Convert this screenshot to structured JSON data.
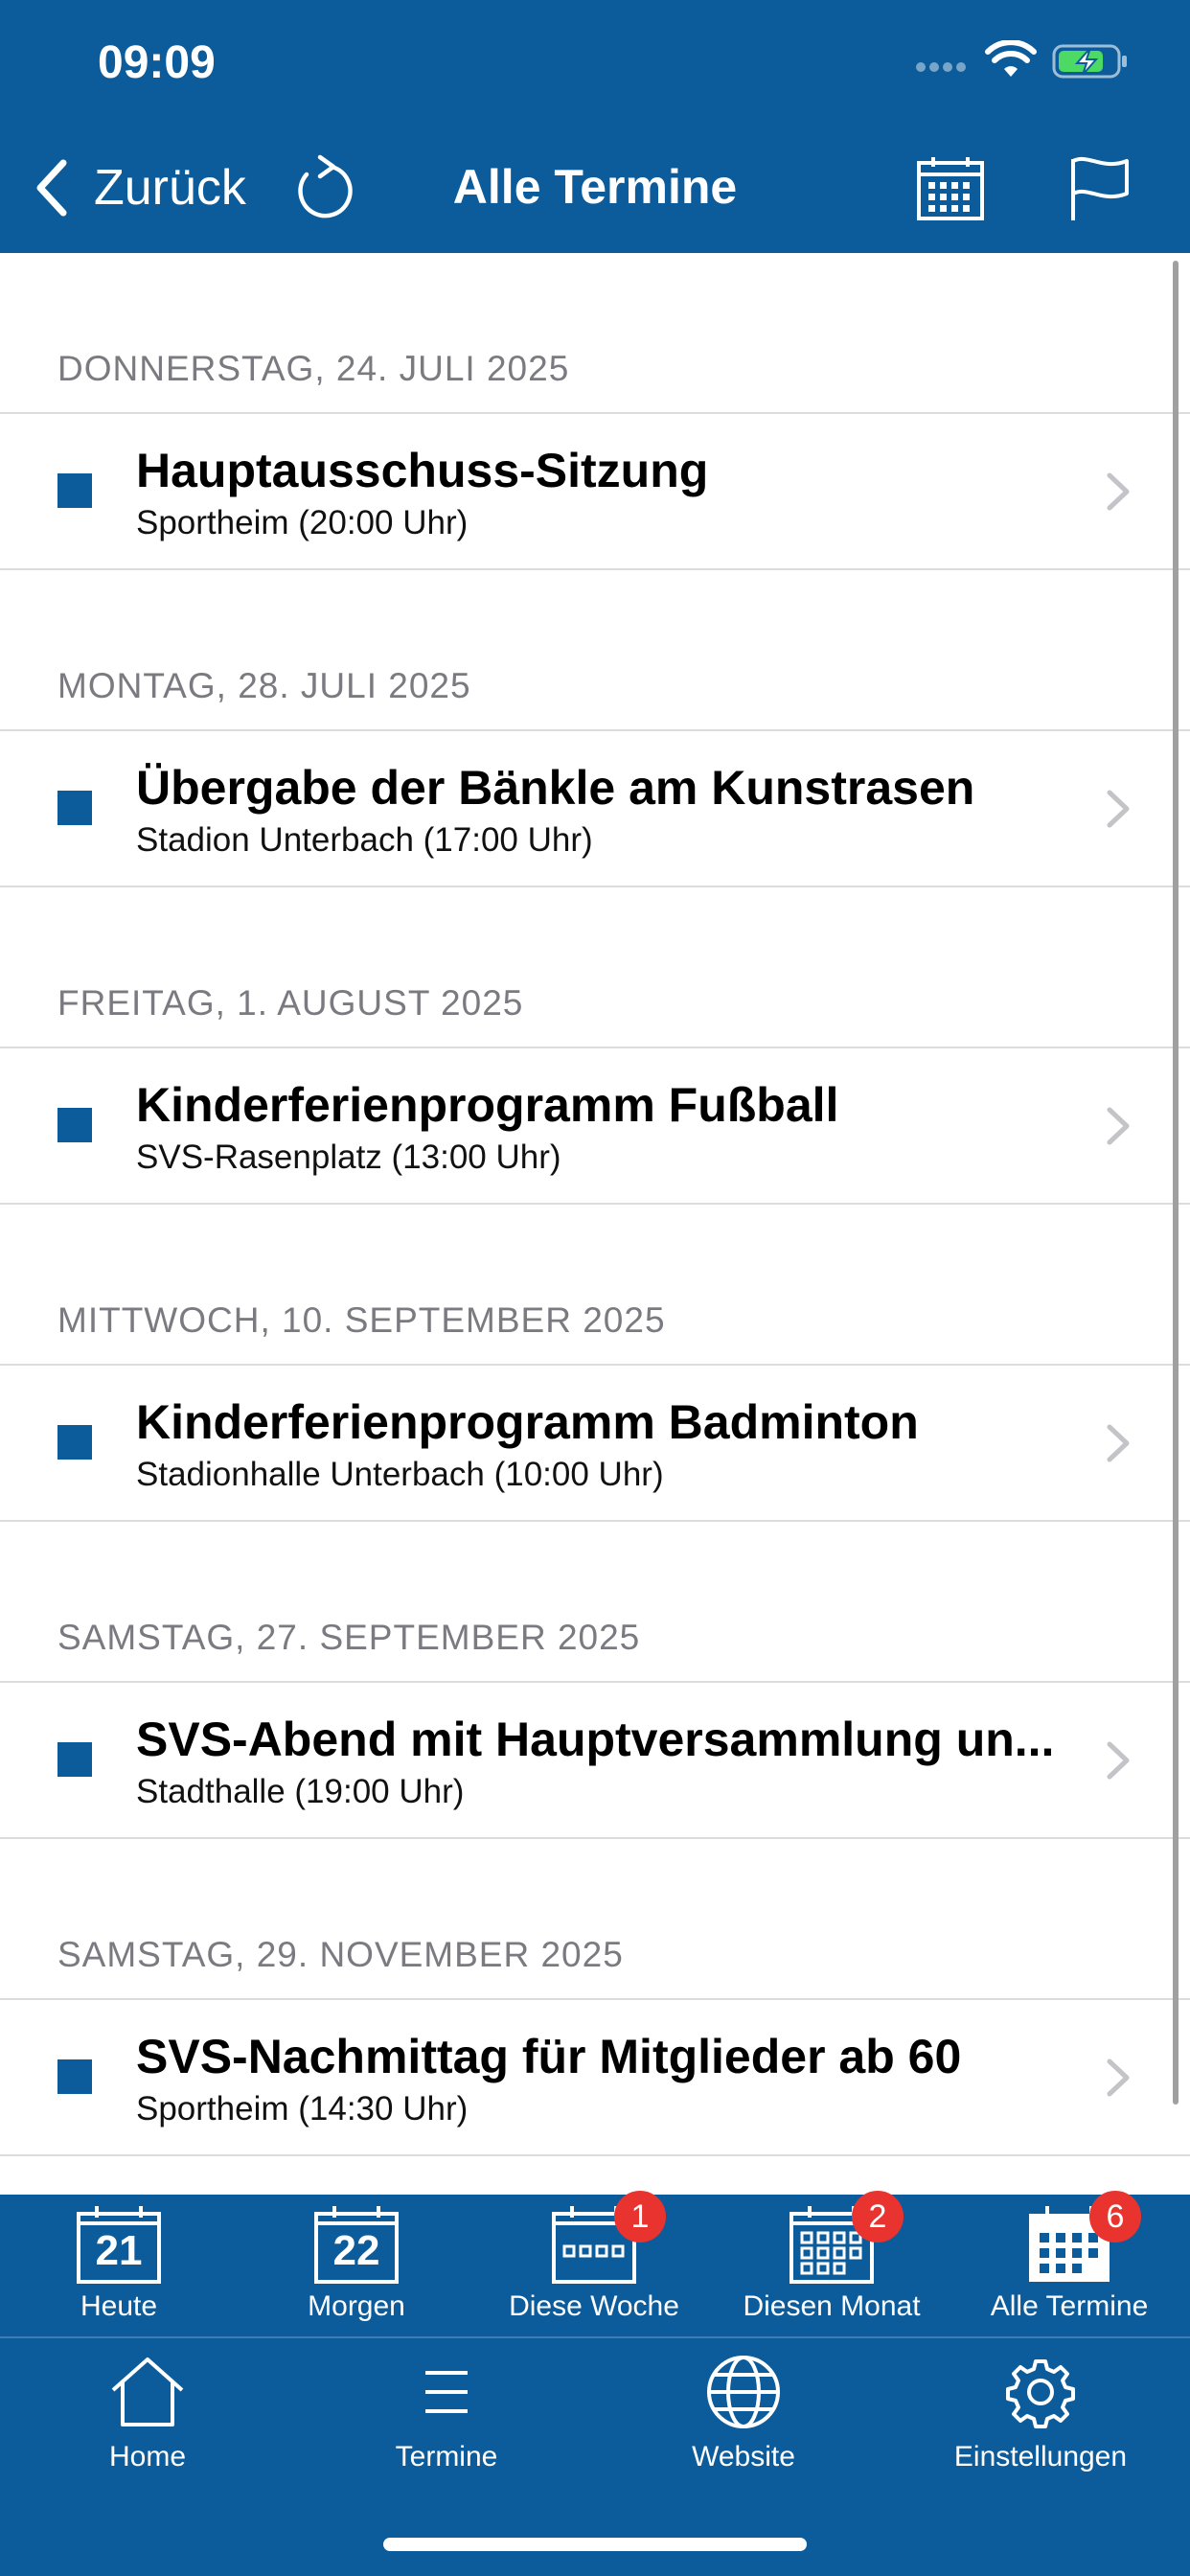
{
  "status": {
    "time": "09:09"
  },
  "nav": {
    "back_label": "Zurück",
    "title": "Alle Termine"
  },
  "sections": [
    {
      "date": "DONNERSTAG, 24. JULI 2025",
      "title": "Hauptausschuss-Sitzung",
      "subtitle": "Sportheim (20:00 Uhr)"
    },
    {
      "date": "MONTAG, 28. JULI 2025",
      "title": "Übergabe der Bänkle am Kunstrasen",
      "subtitle": "Stadion Unterbach (17:00 Uhr)"
    },
    {
      "date": "FREITAG, 1. AUGUST 2025",
      "title": "Kinderferienprogramm Fußball",
      "subtitle": "SVS-Rasenplatz (13:00 Uhr)"
    },
    {
      "date": "MITTWOCH, 10. SEPTEMBER 2025",
      "title": "Kinderferienprogramm Badminton",
      "subtitle": "Stadionhalle Unterbach (10:00 Uhr)"
    },
    {
      "date": "SAMSTAG, 27. SEPTEMBER 2025",
      "title": "SVS-Abend mit Hauptversammlung un...",
      "subtitle": "Stadthalle (19:00 Uhr)"
    },
    {
      "date": "SAMSTAG, 29. NOVEMBER 2025",
      "title": "SVS-Nachmittag für Mitglieder ab 60",
      "subtitle": "Sportheim (14:30 Uhr)"
    }
  ],
  "filter_tabs": [
    {
      "label": "Heute",
      "icon": "calendar-day-icon",
      "day": "21"
    },
    {
      "label": "Morgen",
      "icon": "calendar-day-icon",
      "day": "22"
    },
    {
      "label": "Diese Woche",
      "icon": "calendar-week-icon",
      "badge": "1"
    },
    {
      "label": "Diesen Monat",
      "icon": "calendar-month-icon",
      "badge": "2"
    },
    {
      "label": "Alle Termine",
      "icon": "calendar-all-icon",
      "badge": "6"
    }
  ],
  "main_tabs": [
    {
      "label": "Home",
      "icon": "home-icon"
    },
    {
      "label": "Termine",
      "icon": "list-icon"
    },
    {
      "label": "Website",
      "icon": "globe-icon"
    },
    {
      "label": "Einstellungen",
      "icon": "gear-icon"
    }
  ],
  "colors": {
    "primary": "#0c5c9c",
    "badge": "#e8332f",
    "battery": "#4cd964"
  }
}
